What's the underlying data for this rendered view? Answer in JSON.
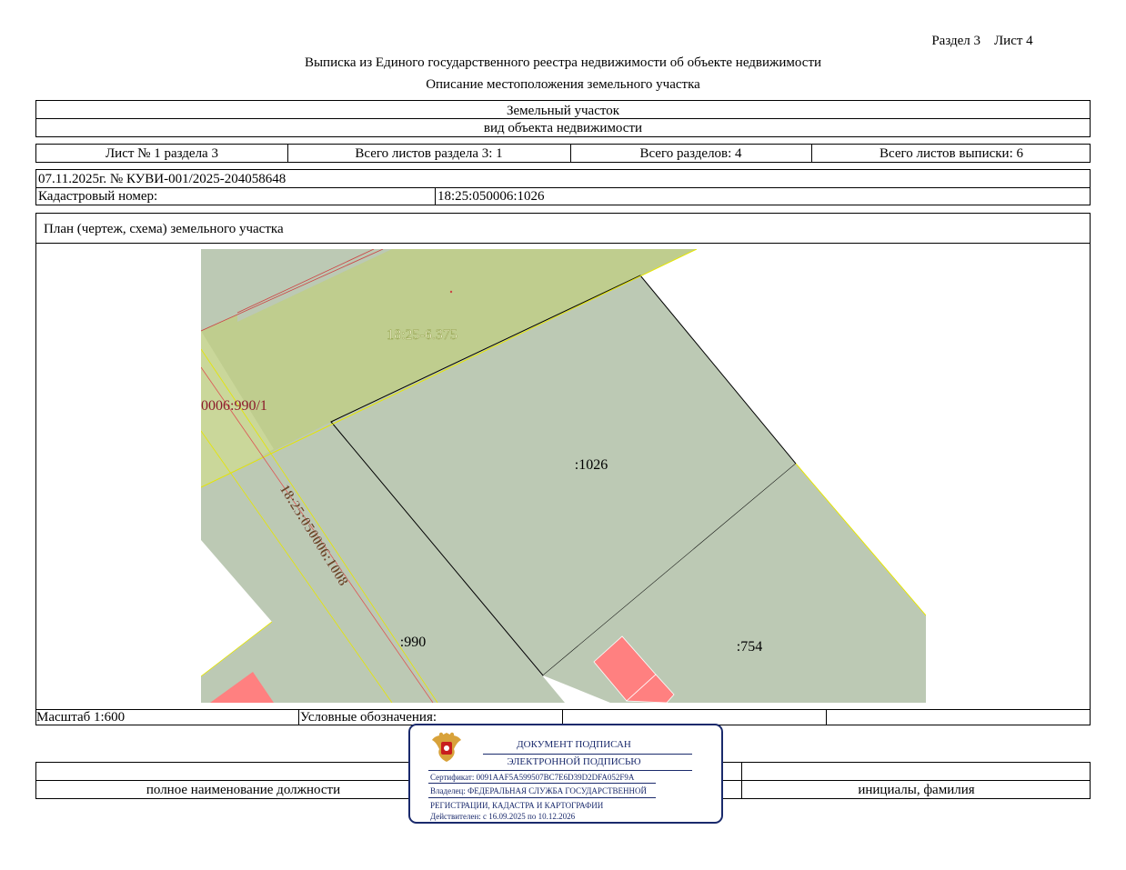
{
  "header": {
    "section_sheet": "Раздел 3    Лист 4",
    "title": "Выписка из Единого государственного реестра недвижимости об объекте недвижимости",
    "subtitle": "Описание местоположения земельного участка"
  },
  "object": {
    "type": "Земельный участок",
    "type_caption": "вид объекта недвижимости"
  },
  "sheets": {
    "sheet_no": "Лист № 1 раздела 3",
    "total_section_sheets": "Всего листов раздела 3: 1",
    "total_sections": "Всего разделов: 4",
    "total_extract_sheets": "Всего листов выписки: 6"
  },
  "doc": {
    "date_number": "07.11.2025г. № КУВИ-001/2025-204058648",
    "cadastral_label": "Кадастровый номер:",
    "cadastral_value": "18:25:050006:1026"
  },
  "plan": {
    "title": "План (чертеж, схема) земельного участка",
    "labels": {
      "zone": "18:25-6.375",
      "partial": "0006:990/1",
      "main": ":1026",
      "road": "18:25:050006:1008",
      "p990": ":990",
      "p754": ":754"
    }
  },
  "footer": {
    "scale": "Масштаб 1:600",
    "legend": "Условные обозначения:",
    "position_caption": "полное наименование должности",
    "signature_caption": "инициалы, фамилия"
  },
  "stamp": {
    "line1": "ДОКУМЕНТ ПОДПИСАН",
    "line2": "ЭЛЕКТРОННОЙ ПОДПИСЬЮ",
    "certificate": "Сертификат: 0091AAF5A599507BC7E6D39D2DFA052F9A",
    "owner1": "Владелец: ФЕДЕРАЛЬНАЯ СЛУЖБА ГОСУДАРСТВЕННОЙ",
    "owner2": "РЕГИСТРАЦИИ, КАДАСТРА И КАРТОГРАФИИ",
    "valid": "Действителен: с 16.09.2025 по 10.12.2026"
  },
  "colors": {
    "parcel_fill": "#bcc9b4",
    "zone_fill": "#bfcd8e",
    "light_zone": "#cad79a",
    "building_fill": "#ff8080",
    "stamp_blue": "#1a2a6c",
    "label_red": "#8b1a2b",
    "label_brown": "#6b4a2a"
  }
}
